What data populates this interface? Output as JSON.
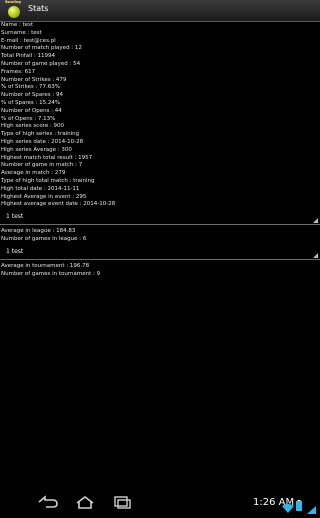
{
  "app": {
    "logo_text": "Bowling",
    "title": "Stats"
  },
  "stats_main": [
    "Name : test",
    "Surname : test",
    "E-mail : test@ces.pl",
    "Number of match played : 12",
    "Total Pinfall : 11994",
    "Number of game played : 54",
    "Frames: 617",
    "Number of Strikes : 479",
    "% of Strikes : 77.63%",
    "Number of Spares : 94",
    "% of Spares : 15.24%",
    "Number of Opens : 44",
    "% of Opens : 7.13%",
    "High series score : 900",
    "Type of high series : training",
    "High series date : 2014-10-28",
    "High series Average : 300",
    "Highest match total result : 1957",
    "Number of game in match : 7",
    "Average in match : 279",
    "Type of high total match : training",
    "High total date : 2014-11-11",
    "Highest Average in event : 295",
    "Highest average event date : 2014-10-28"
  ],
  "league": {
    "spinner_value": "1 test",
    "lines": [
      "Average in league : 184.83",
      "Number of games in league : 6"
    ]
  },
  "tournament": {
    "spinner_value": "1 test",
    "lines": [
      "Average in tournament : 196.78",
      "Number of games in tournament : 9"
    ]
  },
  "status_bar": {
    "time": "1:26 AM"
  },
  "colors": {
    "background": "#000000",
    "actionbar": "#2a2a2a",
    "wifi": "#33b5e5"
  }
}
